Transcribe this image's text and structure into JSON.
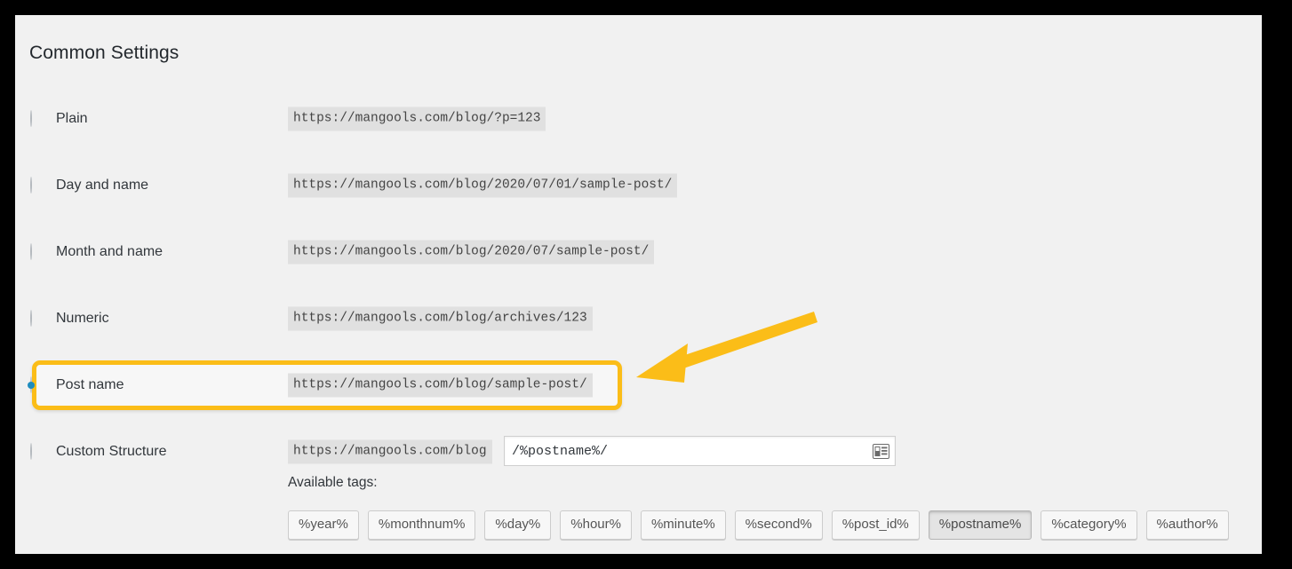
{
  "panel": {
    "title": "Common Settings",
    "background_color": "#f1f1f1",
    "frame_color": "#000000"
  },
  "permalink_options": [
    {
      "id": "plain",
      "label": "Plain",
      "example_url": "https://mangools.com/blog/?p=123",
      "selected": false
    },
    {
      "id": "day-and-name",
      "label": "Day and name",
      "example_url": "https://mangools.com/blog/2020/07/01/sample-post/",
      "selected": false
    },
    {
      "id": "month-and-name",
      "label": "Month and name",
      "example_url": "https://mangools.com/blog/2020/07/sample-post/",
      "selected": false
    },
    {
      "id": "numeric",
      "label": "Numeric",
      "example_url": "https://mangools.com/blog/archives/123",
      "selected": false
    },
    {
      "id": "post-name",
      "label": "Post name",
      "example_url": "https://mangools.com/blog/sample-post/",
      "selected": true
    },
    {
      "id": "custom-structure",
      "label": "Custom Structure",
      "example_url": "https://mangools.com/blog",
      "selected": false
    }
  ],
  "custom_structure": {
    "prefix_url": "https://mangools.com/blog",
    "input_value": "/%postname%/",
    "input_placeholder": "",
    "icon": "form-autofill-icon"
  },
  "available_tags": {
    "label": "Available tags:",
    "items": [
      {
        "label": "%year%",
        "active": false
      },
      {
        "label": "%monthnum%",
        "active": false
      },
      {
        "label": "%day%",
        "active": false
      },
      {
        "label": "%hour%",
        "active": false
      },
      {
        "label": "%minute%",
        "active": false
      },
      {
        "label": "%second%",
        "active": false
      },
      {
        "label": "%post_id%",
        "active": false
      },
      {
        "label": "%postname%",
        "active": true
      },
      {
        "label": "%category%",
        "active": false
      },
      {
        "label": "%author%",
        "active": false
      }
    ]
  },
  "annotation": {
    "highlight_color": "#fbbd18",
    "arrow_color": "#fbbd18",
    "target": "post-name"
  },
  "colors": {
    "radio_selected": "#1e8cbe",
    "code_chip_bg": "#e0e0e0",
    "text": "#32373c"
  }
}
